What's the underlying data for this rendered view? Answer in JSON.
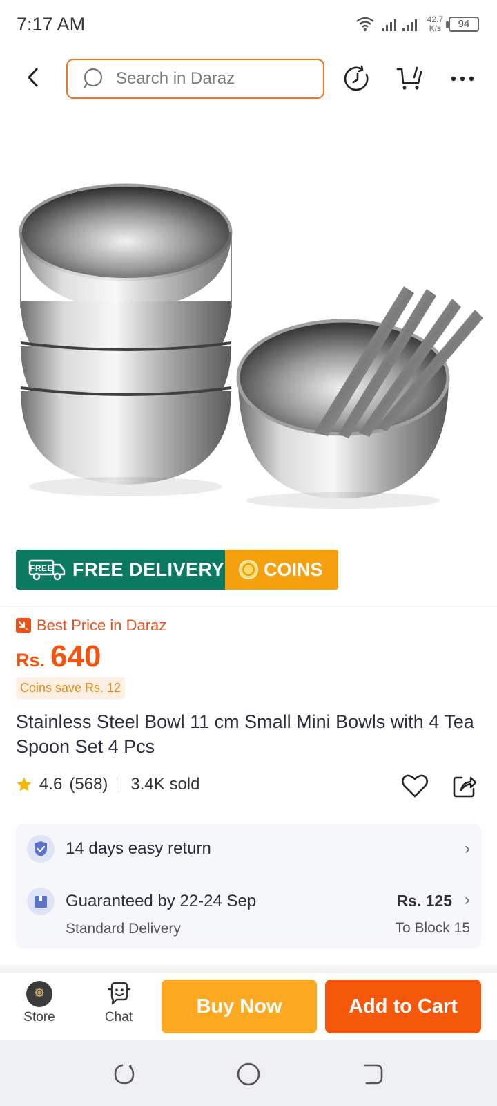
{
  "status_bar": {
    "time": "7:17 AM",
    "speed_value": "42.7",
    "speed_unit": "K/s",
    "battery": "94"
  },
  "search": {
    "placeholder": "Search in Daraz"
  },
  "promo": {
    "free_badge": "FREE",
    "free_delivery": "FREE DELIVERY",
    "coins": "COINS"
  },
  "pricing": {
    "best_price": "Best Price in Daraz",
    "currency": "Rs.",
    "price": "640",
    "coins_save": "Coins save Rs. 12"
  },
  "product": {
    "title": "Stainless Steel Bowl 11 cm Small Mini Bowls with 4 Tea Spoon Set 4 Pcs",
    "rating": "4.6",
    "reviews": "(568)",
    "sold": "3.4K sold"
  },
  "services": {
    "return": "14 days easy return",
    "guarantee": "Guaranteed by 22-24 Sep",
    "delivery_type": "Standard Delivery",
    "delivery_fee": "Rs. 125",
    "delivery_dest": "To Block 15"
  },
  "action_bar": {
    "store": "Store",
    "chat": "Chat",
    "buy_now": "Buy Now",
    "add_to_cart": "Add to Cart"
  },
  "colors": {
    "brand_orange": "#f57224",
    "price_orange": "#f6540e",
    "buy_now": "#fca821",
    "add_to_cart": "#f5580a",
    "delivery_green": "#0c7a61"
  }
}
